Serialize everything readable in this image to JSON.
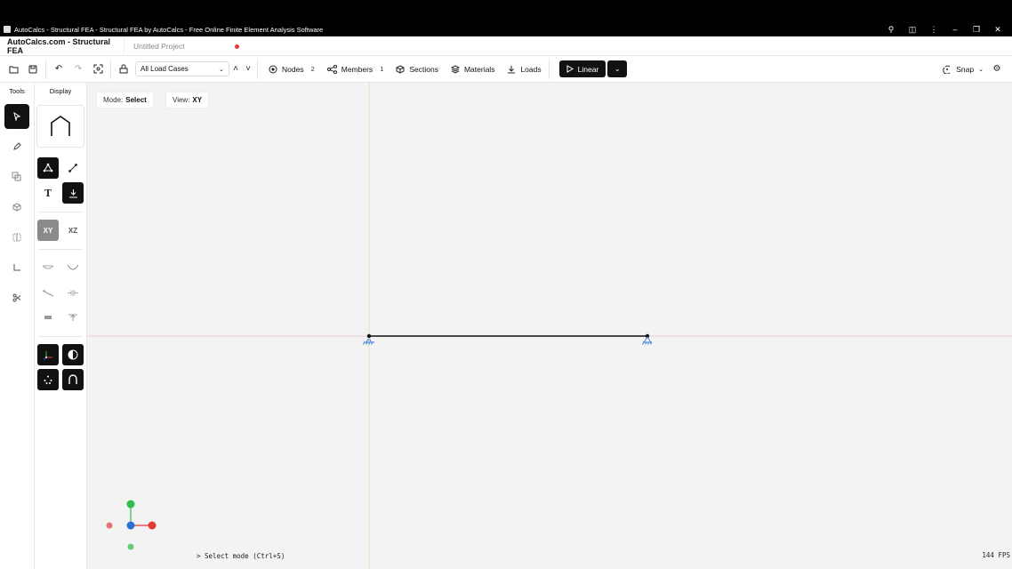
{
  "window": {
    "title": "AutoCalcs - Structural FEA - Structural FEA by AutoCalcs - Free Online Finite Element Analysis Software",
    "icons": [
      "zoom-icon",
      "extensions-icon",
      "more-icon",
      "minimize-icon",
      "restore-icon",
      "close-icon"
    ]
  },
  "app": {
    "name": "AutoCalcs.com - Structural FEA",
    "project_tab": "Untitled Project",
    "unsaved_color": "#e53935"
  },
  "toolbar": {
    "load_case": "All Load Cases",
    "nodes_label": "Nodes",
    "nodes_count": "2",
    "members_label": "Members",
    "members_count": "1",
    "sections_label": "Sections",
    "materials_label": "Materials",
    "loads_label": "Loads",
    "analysis_label": "Linear",
    "snap_label": "Snap"
  },
  "panels": {
    "tools_title": "Tools",
    "display_title": "Display",
    "view_xy": "XY",
    "view_xz": "XZ",
    "text_toggle": "T"
  },
  "canvas": {
    "mode_label": "Mode:",
    "mode_value": "Select",
    "view_label": "View:",
    "view_value": "XY",
    "console_text": "> Select mode (Ctrl+S)",
    "fps_text": "144 FPS",
    "x_axis_color": "#e53935",
    "y_axis_color": "#2ebd4e",
    "z_axis_color": "#2f6fd6",
    "support_color": "#3a7bd5"
  }
}
